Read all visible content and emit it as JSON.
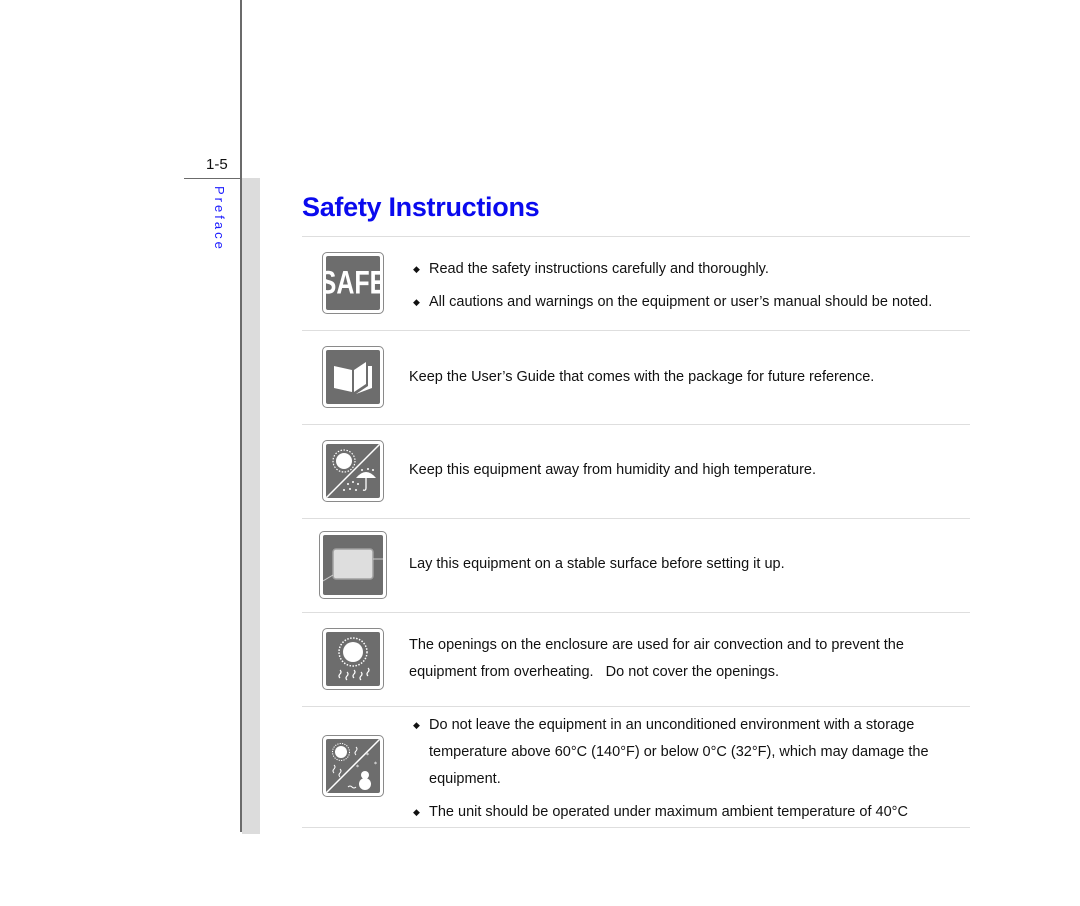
{
  "page": {
    "number": "1-5",
    "section": "Preface",
    "title": "Safety Instructions"
  },
  "colors": {
    "title": "#0a0aee",
    "section": "#1a1aff",
    "icon_fill": "#6d6d6d"
  },
  "items": [
    {
      "icon": "safe-icon",
      "icon_text": "SAFE",
      "bullets": [
        "Read the safety instructions carefully and thoroughly.",
        "All cautions and warnings on the equipment or user’s manual should be noted."
      ]
    },
    {
      "icon": "book-icon",
      "text": "Keep the User’s Guide that comes with the package for future reference."
    },
    {
      "icon": "humidity-temperature-icon",
      "text": "Keep this equipment away from humidity and high temperature."
    },
    {
      "icon": "stable-surface-icon",
      "text": "Lay this equipment on a stable surface before setting it up."
    },
    {
      "icon": "ventilation-icon",
      "text_lines": [
        "The openings on the enclosure are used for air convection and to prevent the",
        "equipment from overheating.   Do not cover the openings."
      ]
    },
    {
      "icon": "storage-temperature-icon",
      "bullets": [
        "Do not leave the equipment in an unconditioned environment with a storage temperature above 60°C (140°F) or below 0°C (32°F), which may damage the equipment.",
        "The unit should be operated under maximum ambient temperature of 40°C"
      ]
    }
  ],
  "bullet_glyph": "◆"
}
